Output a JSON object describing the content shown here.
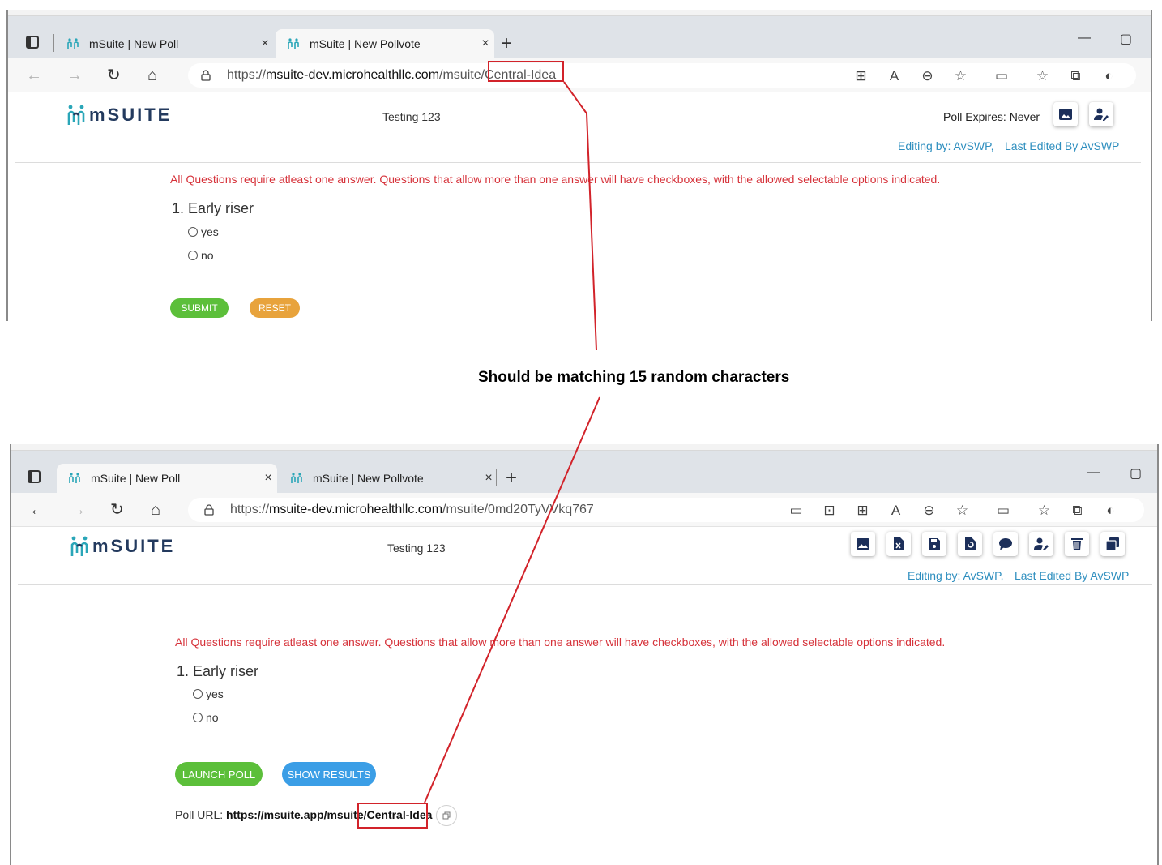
{
  "caption": "Should be matching 15 random characters",
  "colors": {
    "red": "#d2232a",
    "submit_green": "#5cbf3a",
    "reset_orange": "#e8a33c",
    "launch_green": "#5cbf3a",
    "results_blue": "#3b9ee6",
    "link_blue": "#2f8fbf"
  },
  "top": {
    "tabs": [
      {
        "label": "mSuite | New Poll",
        "close": "×"
      },
      {
        "label": "mSuite | New Pollvote",
        "close": "×"
      }
    ],
    "new_tab": "+",
    "window": {
      "minimize": "—",
      "maximize": "▢"
    },
    "url": {
      "scheme": "https://",
      "host": "msuite-dev.microhealthllc.com",
      "path": "/msuite/",
      "slug": "Central-Idea"
    },
    "page": {
      "logo": "mSUITE",
      "title": "Testing 123",
      "expires": "Poll Expires: Never",
      "editing": "Editing by: AvSWP,",
      "last_edited": "Last Edited By AvSWP",
      "notice": "All Questions require atleast one answer. Questions that allow more than one answer will have checkboxes, with the allowed selectable options indicated.",
      "question": "1. Early riser",
      "options": [
        "yes",
        "no"
      ],
      "submit": "SUBMIT",
      "reset": "RESET"
    }
  },
  "bottom": {
    "tabs": [
      {
        "label": "mSuite | New Poll",
        "close": "×"
      },
      {
        "label": "mSuite | New Pollvote",
        "close": "×"
      }
    ],
    "new_tab": "+",
    "window": {
      "minimize": "—",
      "maximize": "▢"
    },
    "url": {
      "scheme": "https://",
      "host": "msuite-dev.microhealthllc.com",
      "path": "/msuite/0md20TyVVkq767"
    },
    "page": {
      "logo": "mSUITE",
      "title": "Testing 123",
      "editing": "Editing by: AvSWP,",
      "last_edited": "Last Edited By AvSWP",
      "notice": "All Questions require atleast one answer. Questions that allow more than one answer will have checkboxes, with the allowed selectable options indicated.",
      "question": "1. Early riser",
      "options": [
        "yes",
        "no"
      ],
      "launch": "LAUNCH POLL",
      "results": "SHOW RESULTS",
      "poll_url_label": "Poll URL:",
      "poll_url_base": "https://msuite.app/msuite/",
      "poll_url_slug": "Central-Idea"
    }
  }
}
